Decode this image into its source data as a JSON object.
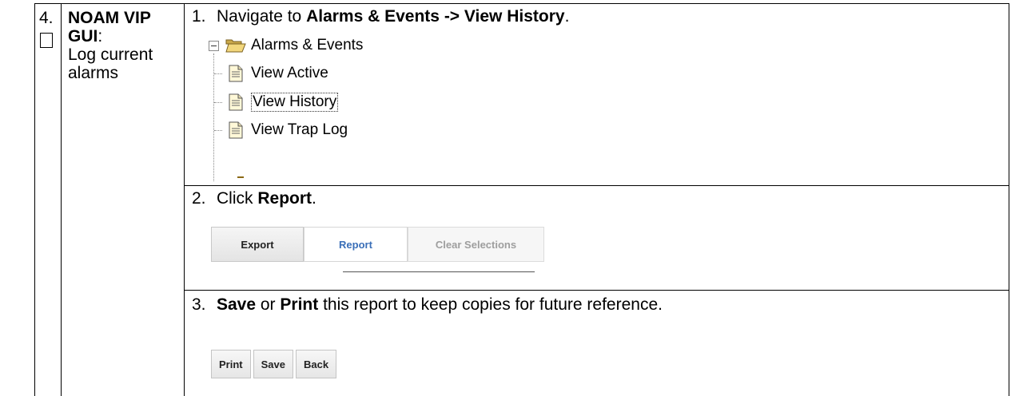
{
  "step": {
    "number": "4.",
    "role": "NOAM VIP GUI",
    "role_suffix": ":",
    "description": "Log current alarms"
  },
  "instructions": {
    "item1": {
      "num": "1.",
      "pre": "Navigate to ",
      "bold": "Alarms & Events -> View History",
      "post": "."
    },
    "tree": {
      "root": "Alarms & Events",
      "children": [
        "View Active",
        "View History",
        "View Trap Log"
      ],
      "selected": "View History"
    },
    "item2": {
      "num": "2.",
      "pre": "Click ",
      "bold": "Report",
      "post": "."
    },
    "buttons1": {
      "export": "Export",
      "report": "Report",
      "clear": "Clear Selections"
    },
    "item3": {
      "num": "3.",
      "bold1": "Save",
      "mid": " or ",
      "bold2": "Print",
      "post": " this report to keep copies for future reference."
    },
    "buttons2": {
      "print": "Print",
      "save": "Save",
      "back": "Back"
    }
  },
  "colors": {
    "report_text": "#3a6fb8",
    "disabled_text": "#9e9e9e",
    "folder_yellow": "#e9c86a"
  }
}
